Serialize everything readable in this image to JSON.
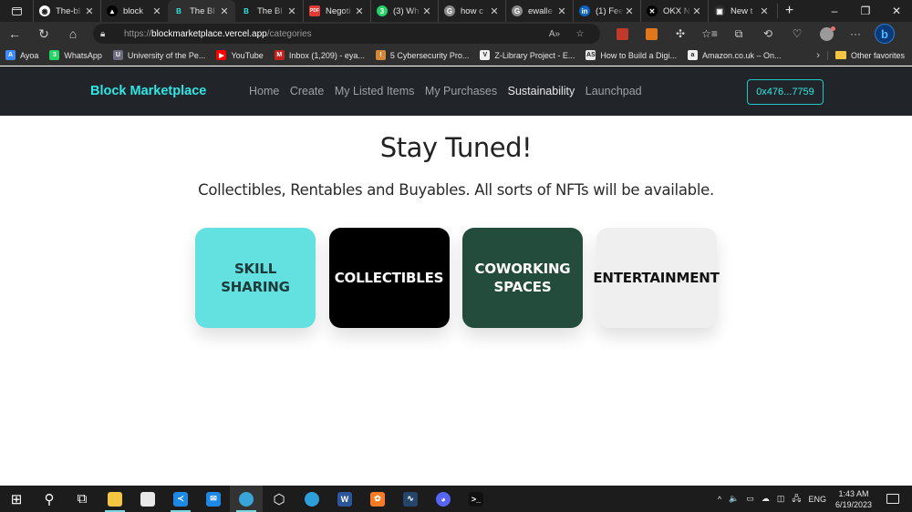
{
  "browser": {
    "tabs": [
      {
        "title": "The-bl",
        "icon": "github-icon",
        "color": "#ffffff",
        "glyph": "◉",
        "active": false
      },
      {
        "title": "block",
        "icon": "vercel-icon",
        "color": "#000000",
        "glyph": "▲",
        "active": false
      },
      {
        "title": "The Bl",
        "icon": "block-marketplace-icon",
        "color": "#2ee6e6",
        "glyph": "B",
        "active": true
      },
      {
        "title": "The Bl",
        "icon": "block-marketplace-icon",
        "color": "#2ee6e6",
        "glyph": "B",
        "active": false
      },
      {
        "title": "Negoti",
        "icon": "pdf-icon",
        "color": "#e53935",
        "glyph": "PDF",
        "active": false
      },
      {
        "title": "(3) Wh",
        "icon": "whatsapp-icon",
        "color": "#25d366",
        "glyph": "3",
        "active": false
      },
      {
        "title": "how c",
        "icon": "google-icon",
        "color": "#8a8a8a",
        "glyph": "G",
        "active": false
      },
      {
        "title": "ewalle",
        "icon": "google-icon",
        "color": "#8a8a8a",
        "glyph": "G",
        "active": false
      },
      {
        "title": "(1) Fee",
        "icon": "linkedin-icon",
        "color": "#0a66c2",
        "glyph": "in",
        "active": false
      },
      {
        "title": "OKX N",
        "icon": "okx-icon",
        "color": "#000000",
        "glyph": "✕",
        "active": false
      },
      {
        "title": "New t",
        "icon": "new-tab-icon",
        "color": "#2f2f2f",
        "glyph": "▣",
        "active": false
      }
    ],
    "new_tab_label": "+",
    "window_controls": {
      "minimize": "–",
      "restore": "❐",
      "close": "✕"
    },
    "url": {
      "scheme": "https://",
      "host": "blockmarketplace.vercel.app",
      "path": "/categories"
    },
    "favorites": [
      {
        "label": "Ayoa",
        "icon": "ayoa-icon",
        "color": "#3d8bfd",
        "glyph": "A"
      },
      {
        "label": "WhatsApp",
        "icon": "whatsapp-icon",
        "color": "#25d366",
        "glyph": "3"
      },
      {
        "label": "University of the Pe...",
        "icon": "university-icon",
        "color": "#6d6d7d",
        "glyph": "U"
      },
      {
        "label": "YouTube",
        "icon": "youtube-icon",
        "color": "#ff0000",
        "glyph": "▶"
      },
      {
        "label": "Inbox (1,209) - eya...",
        "icon": "gmail-icon",
        "color": "#c5221f",
        "glyph": "M"
      },
      {
        "label": "5 Cybersecurity Pro...",
        "icon": "bookmark-icon",
        "color": "#d4883a",
        "glyph": "!"
      },
      {
        "label": "Z-Library Project - E...",
        "icon": "zlibrary-icon",
        "color": "#f0f0f0",
        "glyph": "V"
      },
      {
        "label": "How to Build a Digi...",
        "icon": "as-icon",
        "color": "#e8e8e8",
        "glyph": "AS"
      },
      {
        "label": "Amazon.co.uk – On...",
        "icon": "amazon-icon",
        "color": "#f0f0f0",
        "glyph": "a"
      }
    ],
    "favorites_more": "›",
    "other_favorites": "Other favorites"
  },
  "site": {
    "brand": "Block Marketplace",
    "nav": [
      {
        "label": "Home",
        "active": false
      },
      {
        "label": "Create",
        "active": false
      },
      {
        "label": "My Listed Items",
        "active": false
      },
      {
        "label": "My Purchases",
        "active": false
      },
      {
        "label": "Sustainability",
        "active": true
      },
      {
        "label": "Launchpad",
        "active": false
      }
    ],
    "wallet": "0x476...7759",
    "colors": {
      "accent": "#2ee6e6",
      "navbar_bg": "#212529"
    }
  },
  "main": {
    "headline": "Stay Tuned!",
    "subline": "Collectibles, Rentables and Buyables. All sorts of NFTs will be available.",
    "categories": [
      {
        "label": "SKILL SHARING",
        "bg": "#63e0e0",
        "fg": "#1d3a3a"
      },
      {
        "label": "COLLECTIBLES",
        "bg": "#000000",
        "fg": "#ffffff"
      },
      {
        "label": "COWORKING SPACES",
        "bg": "#244c3d",
        "fg": "#ffffff"
      },
      {
        "label": "ENTERTAINMENT",
        "bg": "#efefef",
        "fg": "#111111"
      }
    ]
  },
  "taskbar": {
    "apps": [
      {
        "name": "start-icon",
        "glyph": "⊞",
        "color": "transparent",
        "running": false,
        "active": false
      },
      {
        "name": "search-icon",
        "glyph": "⚲",
        "color": "transparent",
        "running": false,
        "active": false
      },
      {
        "name": "task-view-icon",
        "glyph": "⧉",
        "color": "transparent",
        "running": false,
        "active": false
      },
      {
        "name": "file-explorer-icon",
        "glyph": "",
        "color": "#f4c542",
        "running": true,
        "active": false
      },
      {
        "name": "microsoft-store-icon",
        "glyph": "",
        "color": "#e8e8e8",
        "running": false,
        "active": false
      },
      {
        "name": "vscode-icon",
        "glyph": "≺",
        "color": "#1e88e5",
        "running": true,
        "active": false
      },
      {
        "name": "mail-icon",
        "glyph": "✉",
        "color": "#1e88e5",
        "running": false,
        "active": false
      },
      {
        "name": "edge-icon",
        "glyph": "",
        "color": "#3aa3d8",
        "running": true,
        "active": true
      },
      {
        "name": "virtualbox-icon",
        "glyph": "⬡",
        "color": "transparent",
        "running": false,
        "active": false
      },
      {
        "name": "edge-profile-icon",
        "glyph": "",
        "color": "#2e9fd8",
        "running": false,
        "active": false
      },
      {
        "name": "word-icon",
        "glyph": "W",
        "color": "#2b579a",
        "running": false,
        "active": false
      },
      {
        "name": "xampp-icon",
        "glyph": "✿",
        "color": "#fb7a24",
        "running": false,
        "active": false
      },
      {
        "name": "mysql-workbench-icon",
        "glyph": "∿",
        "color": "#25466b",
        "running": false,
        "active": false
      },
      {
        "name": "discord-icon",
        "glyph": "◕",
        "color": "#5865f2",
        "running": false,
        "active": false
      },
      {
        "name": "terminal-icon",
        "glyph": ">_",
        "color": "#111111",
        "running": false,
        "active": false
      }
    ],
    "tray": {
      "chevron": "^",
      "volume": "🔈",
      "battery": "▭",
      "cloud": "☁",
      "meet": "◫",
      "network": "🖧",
      "language": "ENG",
      "time": "1:43 AM",
      "date": "6/19/2023"
    }
  }
}
